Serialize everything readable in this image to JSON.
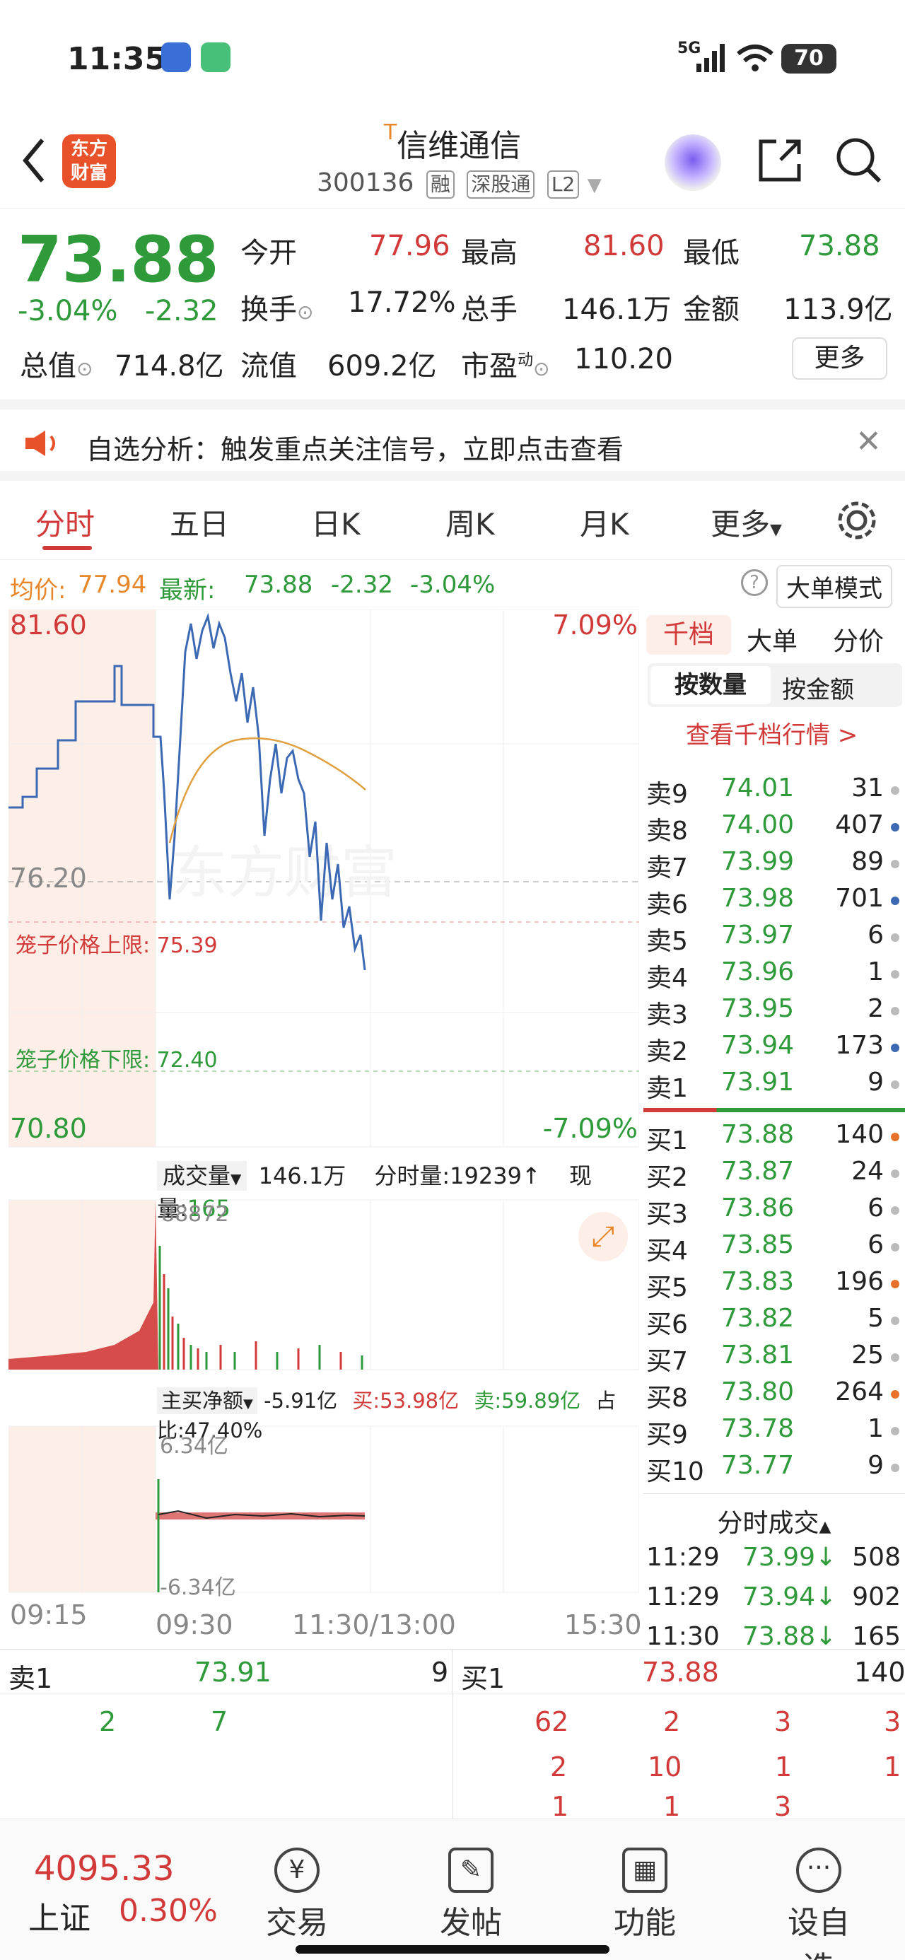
{
  "status": {
    "time": "11:35",
    "network": "5G",
    "battery": "70"
  },
  "header": {
    "back_icon": "chevron-left-icon",
    "logo_line1": "东方",
    "logo_line2": "财富",
    "stock_name_mark": "T",
    "stock_name": "信维通信",
    "stock_code": "300136",
    "tags": [
      "融",
      "深股通",
      "L2"
    ]
  },
  "quote": {
    "price": "73.88",
    "change_pct": "-3.04%",
    "change": "-2.32",
    "open_label": "今开",
    "open": "77.96",
    "high_label": "最高",
    "high": "81.60",
    "low_label": "最低",
    "low": "73.88",
    "turnover_label": "换手",
    "turnover": "17.72%",
    "volume_label": "总手",
    "volume": "146.1万",
    "amount_label": "金额",
    "amount": "113.9亿",
    "mktcap_label": "总值",
    "mktcap": "714.8亿",
    "float_label": "流值",
    "float": "609.2亿",
    "pe_label": "市盈",
    "pe_sup": "动",
    "pe": "110.20",
    "more": "更多"
  },
  "notice": {
    "text": "自选分析：触发重点关注信号，立即点击查看"
  },
  "tabs": [
    "分时",
    "五日",
    "日K",
    "周K",
    "月K",
    "更多"
  ],
  "summary": {
    "avg_label": "均价:",
    "avg": "77.94",
    "latest_label": "最新:",
    "latest": "73.88",
    "chg": "-2.32",
    "chg_pct": "-3.04%",
    "mode_button": "大单模式"
  },
  "chart": {
    "top_price": "81.60",
    "top_pct": "7.09%",
    "bottom_price": "70.80",
    "bottom_pct": "-7.09%",
    "prev_close": "76.20",
    "upper_limit_label": "笼子价格上限: 75.39",
    "lower_limit_label": "笼子价格下限: 72.40",
    "watermark": "东方财富",
    "vol_select": "成交量",
    "vol_total": "146.1万",
    "vol_tick": "分时量:19239↑",
    "vol_now_label": "现量:",
    "vol_now": "165",
    "vol_max": "88872",
    "flow_select": "主买净额",
    "flow_net": "-5.91亿",
    "flow_buy": "买:53.98亿",
    "flow_sell": "卖:59.89亿",
    "flow_ratio": "占比:47.40%",
    "flow_top": "6.34亿",
    "flow_bottom": "-6.34亿",
    "time_labels": [
      "09:15",
      "09:30",
      "11:30/13:00",
      "15:30"
    ]
  },
  "side": {
    "tabs": [
      "千档",
      "大单",
      "分价"
    ],
    "sub_tabs": [
      "按数量",
      "按金额"
    ],
    "link": "查看千档行情 >",
    "asks": [
      {
        "label": "卖9",
        "price": "74.01",
        "vol": "31"
      },
      {
        "label": "卖8",
        "price": "74.00",
        "vol": "407"
      },
      {
        "label": "卖7",
        "price": "73.99",
        "vol": "89"
      },
      {
        "label": "卖6",
        "price": "73.98",
        "vol": "701"
      },
      {
        "label": "卖5",
        "price": "73.97",
        "vol": "6"
      },
      {
        "label": "卖4",
        "price": "73.96",
        "vol": "1"
      },
      {
        "label": "卖3",
        "price": "73.95",
        "vol": "2"
      },
      {
        "label": "卖2",
        "price": "73.94",
        "vol": "173"
      },
      {
        "label": "卖1",
        "price": "73.91",
        "vol": "9"
      }
    ],
    "bids": [
      {
        "label": "买1",
        "price": "73.88",
        "vol": "140"
      },
      {
        "label": "买2",
        "price": "73.87",
        "vol": "24"
      },
      {
        "label": "买3",
        "price": "73.86",
        "vol": "6"
      },
      {
        "label": "买4",
        "price": "73.85",
        "vol": "6"
      },
      {
        "label": "买5",
        "price": "73.83",
        "vol": "196"
      },
      {
        "label": "买6",
        "price": "73.82",
        "vol": "5"
      },
      {
        "label": "买7",
        "price": "73.81",
        "vol": "25"
      },
      {
        "label": "买8",
        "price": "73.80",
        "vol": "264"
      },
      {
        "label": "买9",
        "price": "73.78",
        "vol": "1"
      },
      {
        "label": "买10",
        "price": "73.77",
        "vol": "9"
      }
    ],
    "ticks_title": "分时成交",
    "ticks": [
      {
        "time": "11:29",
        "price": "73.99↓",
        "vol": "508"
      },
      {
        "time": "11:29",
        "price": "73.94↓",
        "vol": "902"
      },
      {
        "time": "11:30",
        "price": "73.88↓",
        "vol": "165"
      }
    ]
  },
  "bottom_book": {
    "ask_label": "卖1",
    "ask_price": "73.91",
    "ask_vol": "9",
    "bid_label": "买1",
    "bid_price": "73.88",
    "bid_vol": "140",
    "ask_queue": [
      "2",
      "7"
    ],
    "bid_queue_row1": [
      "62",
      "2",
      "3",
      "3"
    ],
    "bid_queue_row2": [
      "2",
      "10",
      "1",
      "1"
    ],
    "bid_queue_row3": [
      "1",
      "1",
      "3"
    ]
  },
  "navbar": {
    "index_value": "4095.33",
    "index_name": "上证",
    "index_pct": "0.30%",
    "items": [
      "交易",
      "发帖",
      "功能",
      "设自选"
    ]
  }
}
